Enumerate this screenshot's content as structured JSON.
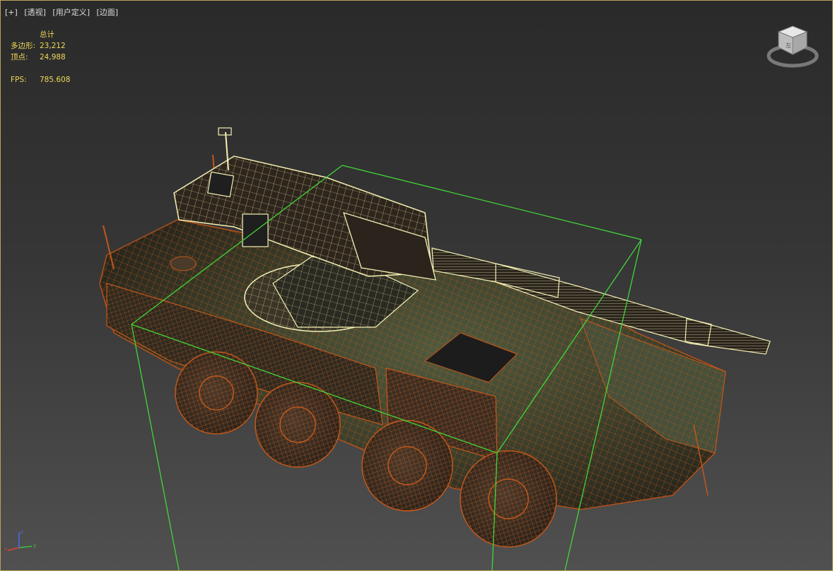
{
  "viewport": {
    "labels": [
      "[+]",
      "[透视]",
      "[用户定义]",
      "[边面]"
    ],
    "stats": {
      "header": "总计",
      "polygons_label": "多边形:",
      "polygons_value": "23,212",
      "vertices_label": "顶点:",
      "vertices_value": "24,988",
      "fps_label": "FPS:",
      "fps_value": "785.608"
    },
    "viewcube": {
      "face_label": "左"
    },
    "axis": {
      "x": "x",
      "y": "y",
      "z": "z"
    }
  },
  "colors": {
    "border": "#b8a25a",
    "stats_text": "#f0d85a",
    "wire_orange": "#c0581c",
    "wire_selected": "#f4f0b4",
    "bounding_box": "#41d63a"
  }
}
